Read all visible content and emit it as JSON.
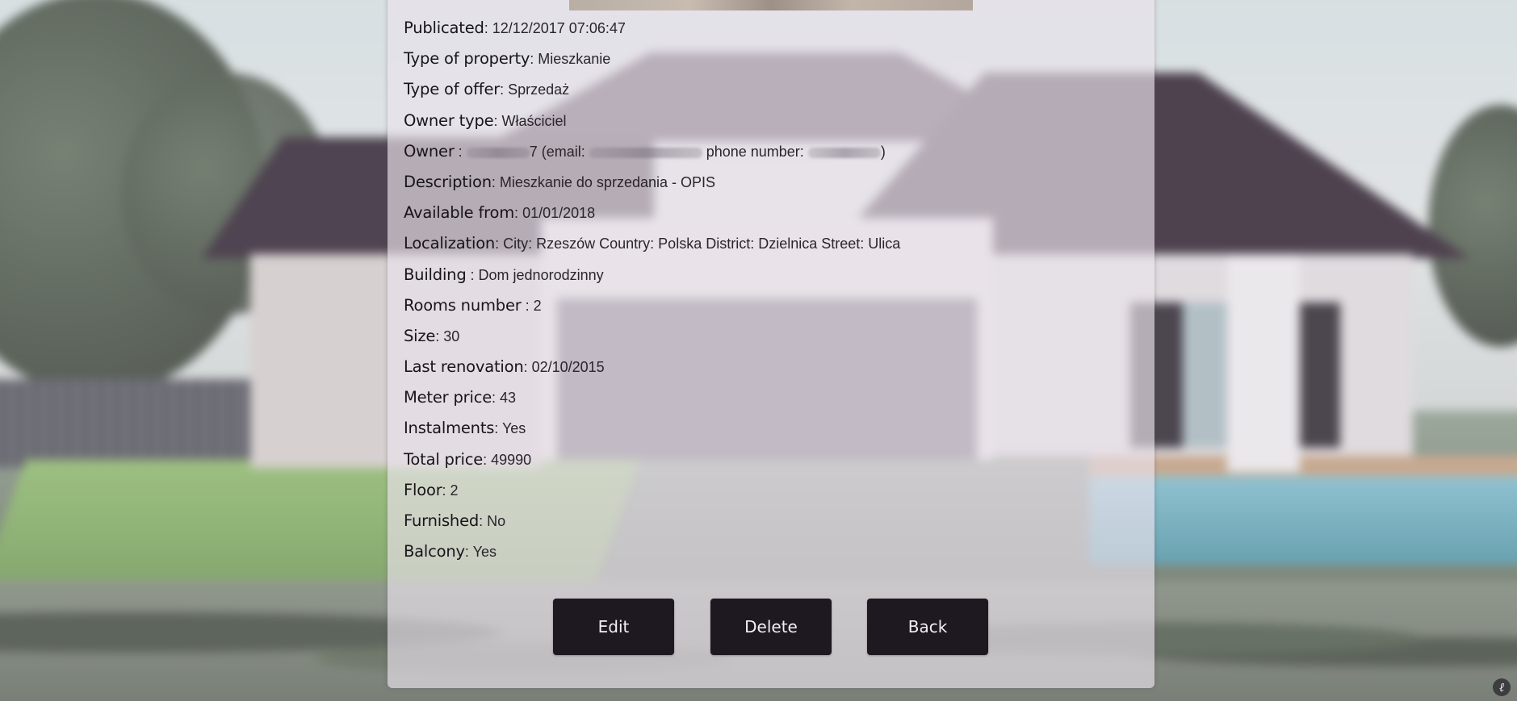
{
  "details": {
    "publicated": {
      "label": "Publicated",
      "sep": ": ",
      "value": "12/12/2017 07:06:47"
    },
    "type_property": {
      "label": "Type of property",
      "sep": ": ",
      "value": "Mieszkanie"
    },
    "type_offer": {
      "label": "Type of offer",
      "sep": ": ",
      "value": "Sprzedaż"
    },
    "owner_type": {
      "label": "Owner type",
      "sep": ": ",
      "value": "Właściciel"
    },
    "owner": {
      "label": "Owner",
      "sep": " : ",
      "name_tail": "7",
      "email_prefix": " (email: ",
      "phone_prefix": " phone number: ",
      "close": ")"
    },
    "description": {
      "label": "Description",
      "sep": ": ",
      "value": "Mieszkanie do sprzedania - OPIS"
    },
    "available_from": {
      "label": "Available from",
      "sep": ": ",
      "value": "01/01/2018"
    },
    "localization": {
      "label": "Localization",
      "sep": ": ",
      "value": "City: Rzeszów Country: Polska District: Dzielnica Street: Ulica"
    },
    "building": {
      "label": "Building",
      "sep": " : ",
      "value": "Dom jednorodzinny"
    },
    "rooms_number": {
      "label": "Rooms number",
      "sep": " : ",
      "value": "2"
    },
    "size": {
      "label": "Size",
      "sep": ": ",
      "value": "30"
    },
    "last_renovation": {
      "label": "Last renovation",
      "sep": ": ",
      "value": "02/10/2015"
    },
    "meter_price": {
      "label": "Meter price",
      "sep": ": ",
      "value": "43"
    },
    "instalments": {
      "label": "Instalments",
      "sep": ": ",
      "value": "Yes"
    },
    "total_price": {
      "label": "Total price",
      "sep": ": ",
      "value": "49990"
    },
    "floor": {
      "label": "Floor",
      "sep": ": ",
      "value": "2"
    },
    "furnished": {
      "label": "Furnished",
      "sep": ": ",
      "value": "No"
    },
    "balcony": {
      "label": "Balcony",
      "sep": ": ",
      "value": "Yes"
    }
  },
  "buttons": {
    "edit": "Edit",
    "delete": "Delete",
    "back": "Back"
  },
  "corner_icon": {
    "glyph": "ℓ",
    "icon": "symfony-toolbar-icon"
  },
  "colors": {
    "button_bg": "#1e1820",
    "panel_bg": "#eae2ec"
  }
}
